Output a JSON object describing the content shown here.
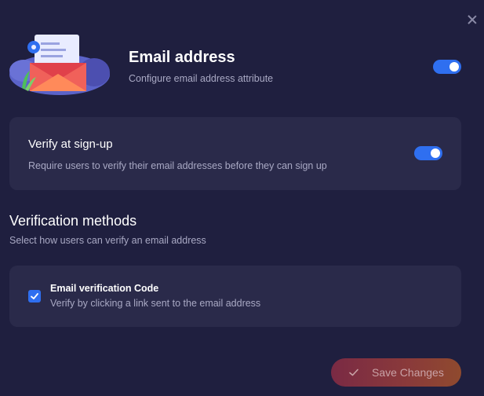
{
  "header": {
    "title": "Email address",
    "subtitle": "Configure email address attribute",
    "enabled": true
  },
  "verify_card": {
    "title": "Verify at sign-up",
    "subtitle": "Require users to verify their email addresses before they can sign up",
    "enabled": true
  },
  "methods": {
    "title": "Verification methods",
    "subtitle": "Select how users can verify an email address",
    "option": {
      "title": "Email verification Code",
      "subtitle": "Verify by clicking a link sent to the email address",
      "checked": true
    }
  },
  "footer": {
    "save_label": "Save Changes"
  },
  "colors": {
    "background": "#1f1f3f",
    "card": "#2a2a4a",
    "accent": "#2f6ff0"
  }
}
